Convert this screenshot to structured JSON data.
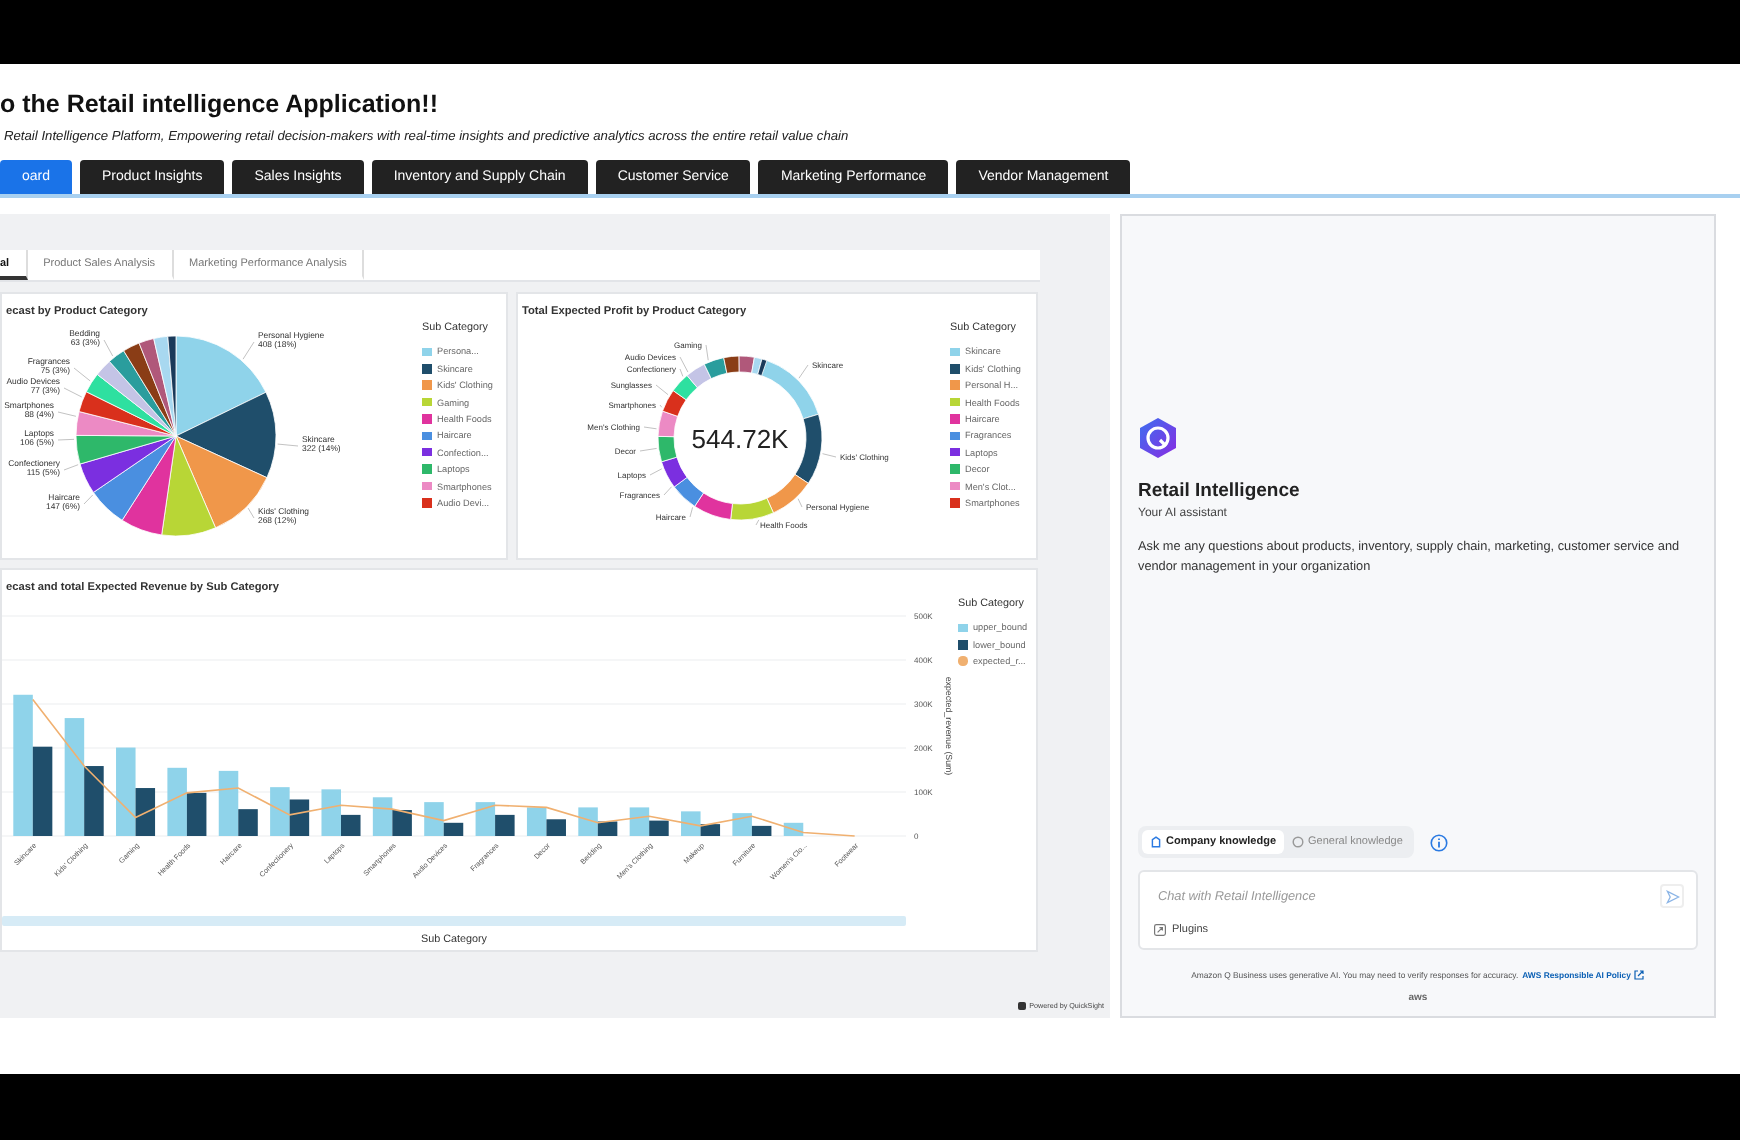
{
  "header": {
    "title": "o the Retail intelligence Application!!",
    "subtitle": "Retail Intelligence Platform, Empowering retail decision-makers with real-time insights and predictive analytics across the entire retail value chain"
  },
  "tabs": [
    {
      "label": "oard",
      "selected": true
    },
    {
      "label": "Product Insights",
      "selected": false
    },
    {
      "label": "Sales Insights",
      "selected": false
    },
    {
      "label": "Inventory and Supply Chain",
      "selected": false
    },
    {
      "label": "Customer Service",
      "selected": false
    },
    {
      "label": "Marketing Performance",
      "selected": false
    },
    {
      "label": "Vendor Management",
      "selected": false
    }
  ],
  "sheet_tabs": [
    {
      "label": "al",
      "selected": true
    },
    {
      "label": "Product Sales Analysis",
      "selected": false
    },
    {
      "label": "Marketing Performance Analysis",
      "selected": false
    }
  ],
  "pie_card": {
    "title": "ecast by Product Category",
    "legend_title": "Sub Category",
    "slice_labels": [
      {
        "name": "Bedding",
        "value": "63 (3%)"
      },
      {
        "name": "Personal Hygiene",
        "value": "408 (18%)"
      },
      {
        "name": "Fragrances",
        "value": "75 (3%)"
      },
      {
        "name": "Audio Devices",
        "value": "77 (3%)"
      },
      {
        "name": "Smartphones",
        "value": "88 (4%)"
      },
      {
        "name": "Laptops",
        "value": "106 (5%)"
      },
      {
        "name": "Skincare",
        "value": "322 (14%)"
      },
      {
        "name": "Confectionery",
        "value": "115 (5%)"
      },
      {
        "name": "Haircare",
        "value": "147 (6%)"
      },
      {
        "name": "Kids' Clothing",
        "value": "268 (12%)"
      }
    ],
    "legend": [
      {
        "label": "Persona...",
        "color": "#8fd3ea"
      },
      {
        "label": "Skincare",
        "color": "#1f4e6b"
      },
      {
        "label": "Kids' Clothing",
        "color": "#f0974a"
      },
      {
        "label": "Gaming",
        "color": "#b8d636"
      },
      {
        "label": "Health Foods",
        "color": "#e0339e"
      },
      {
        "label": "Haircare",
        "color": "#4a8fe0"
      },
      {
        "label": "Confection...",
        "color": "#7b2fe0"
      },
      {
        "label": "Laptops",
        "color": "#2eb86a"
      },
      {
        "label": "Smartphones",
        "color": "#ec8ac4"
      },
      {
        "label": "Audio Devi...",
        "color": "#d9301c"
      }
    ]
  },
  "donut_card": {
    "title": "Total Expected Profit by Product Category",
    "total": "544.72K",
    "legend_title": "Sub Category",
    "slice_labels": [
      "Gaming",
      "Audio Devices",
      "Skincare",
      "Confectionery",
      "Sunglasses",
      "Smartphones",
      "Men's Clothing",
      "Decor",
      "Kids' Clothing",
      "Laptops",
      "Fragrances",
      "Personal Hygiene",
      "Haircare",
      "Health Foods"
    ],
    "legend": [
      {
        "label": "Skincare",
        "color": "#8fd3ea"
      },
      {
        "label": "Kids' Clothing",
        "color": "#1f4e6b"
      },
      {
        "label": "Personal H...",
        "color": "#f0974a"
      },
      {
        "label": "Health Foods",
        "color": "#b8d636"
      },
      {
        "label": "Haircare",
        "color": "#e0339e"
      },
      {
        "label": "Fragrances",
        "color": "#4a8fe0"
      },
      {
        "label": "Laptops",
        "color": "#7b2fe0"
      },
      {
        "label": "Decor",
        "color": "#2eb86a"
      },
      {
        "label": "Men's Clot...",
        "color": "#ec8ac4"
      },
      {
        "label": "Smartphones",
        "color": "#d9301c"
      }
    ]
  },
  "bar_card": {
    "title": "ecast and total Expected Revenue by Sub Category",
    "legend_title": "Sub Category",
    "chart_data": {
      "type": "bar",
      "xlabel": "Sub Category",
      "ylabel": "expected_revenue (Sum)",
      "grid": true,
      "categories": [
        "Skincare",
        "Kids' Clothing",
        "Gaming",
        "Health Foods",
        "Haircare",
        "Confectionery",
        "Laptops",
        "Smartphones",
        "Audio Devices",
        "Fragrances",
        "Decor",
        "Bedding",
        "Men's Clothing",
        "Makeup",
        "Furniture",
        "Women's Clo...",
        "Footwear"
      ],
      "series": [
        {
          "name": "upper_bound",
          "type": "bar",
          "color": "#8fd3ea",
          "values": [
            321,
            268,
            201,
            155,
            148,
            111,
            106,
            88,
            77,
            77,
            65,
            65,
            65,
            56,
            52,
            30,
            null
          ]
        },
        {
          "name": "lower_bound",
          "type": "bar",
          "color": "#1f4e6b",
          "values": [
            203,
            159,
            109,
            98,
            61,
            83,
            48,
            59,
            30,
            48,
            38,
            33,
            35,
            27,
            23,
            0,
            0
          ]
        },
        {
          "name": "expected_r...",
          "type": "line",
          "color": "#f0b070",
          "values": [
            310,
            159,
            42,
            98,
            109,
            48,
            70,
            61,
            35,
            70,
            65,
            30,
            45,
            23,
            45,
            8,
            0
          ]
        }
      ],
      "ylim": [
        0,
        500
      ],
      "yticks": [
        {
          "value": 0,
          "label": "0"
        },
        {
          "value": 100,
          "label": "100K"
        },
        {
          "value": 200,
          "label": "200K"
        },
        {
          "value": 300,
          "label": "300K"
        },
        {
          "value": 400,
          "label": "400K"
        },
        {
          "value": 500,
          "label": "500K"
        }
      ]
    }
  },
  "footer_badge": "Powered by QuickSight",
  "assistant": {
    "name": "Retail Intelligence",
    "tagline": "Your AI assistant",
    "intro": "Ask me any questions about products, inventory, supply chain, marketing, customer service and vendor management in your organization",
    "modes": [
      {
        "label": "Company knowledge",
        "selected": true
      },
      {
        "label": "General knowledge",
        "selected": false
      }
    ],
    "input": {
      "placeholder": "Chat with Retail Intelligence"
    },
    "plugins": "Plugins",
    "disclaimer": "Amazon Q Business uses generative AI. You may need to verify responses for accuracy.",
    "policy_link": "AWS Responsible AI Policy",
    "brand": "aws"
  }
}
